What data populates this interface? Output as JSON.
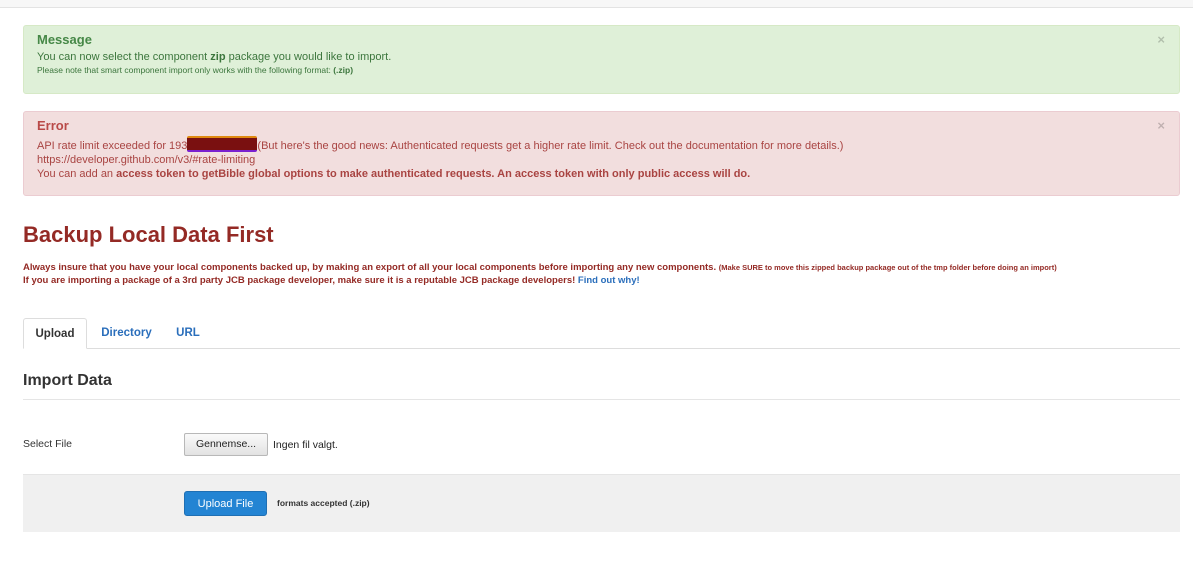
{
  "message": {
    "title": "Message",
    "line1_pre": "You can now select the component ",
    "line1_bold": "zip",
    "line1_post": " package you would like to import.",
    "line2_pre": "Please note that smart component import only works with the following format: ",
    "line2_bold": "(.zip)",
    "close": "×"
  },
  "error": {
    "title": "Error",
    "line1_pre": "API rate limit exceeded for 193",
    "line1_post": "(But here's the good news: Authenticated requests get a higher rate limit. Check out the documentation for more details.)",
    "line2": "https://developer.github.com/v3/#rate-limiting",
    "line3_pre": "You can add an ",
    "line3_bold": "access token to getBible global options to make authenticated requests. An access token with only public access will do.",
    "close": "×"
  },
  "backup": {
    "title": "Backup Local Data First",
    "line1": "Always insure that you have your local components backed up, by making an export of all your local components before importing any new components. ",
    "line1_small": "(Make SURE to move this zipped backup package out of the tmp folder before doing an import)",
    "line2": "If you are importing a package of a 3rd party JCB package developer, make sure it is a reputable JCB package developers! ",
    "line2_link": "Find out why!"
  },
  "tabs": [
    "Upload",
    "Directory",
    "URL"
  ],
  "import": {
    "title": "Import Data",
    "select_label": "Select File",
    "browse_button": "Gennemse...",
    "no_file": "Ingen fil valgt.",
    "upload_button": "Upload File",
    "formats": "formats accepted (.zip)"
  }
}
